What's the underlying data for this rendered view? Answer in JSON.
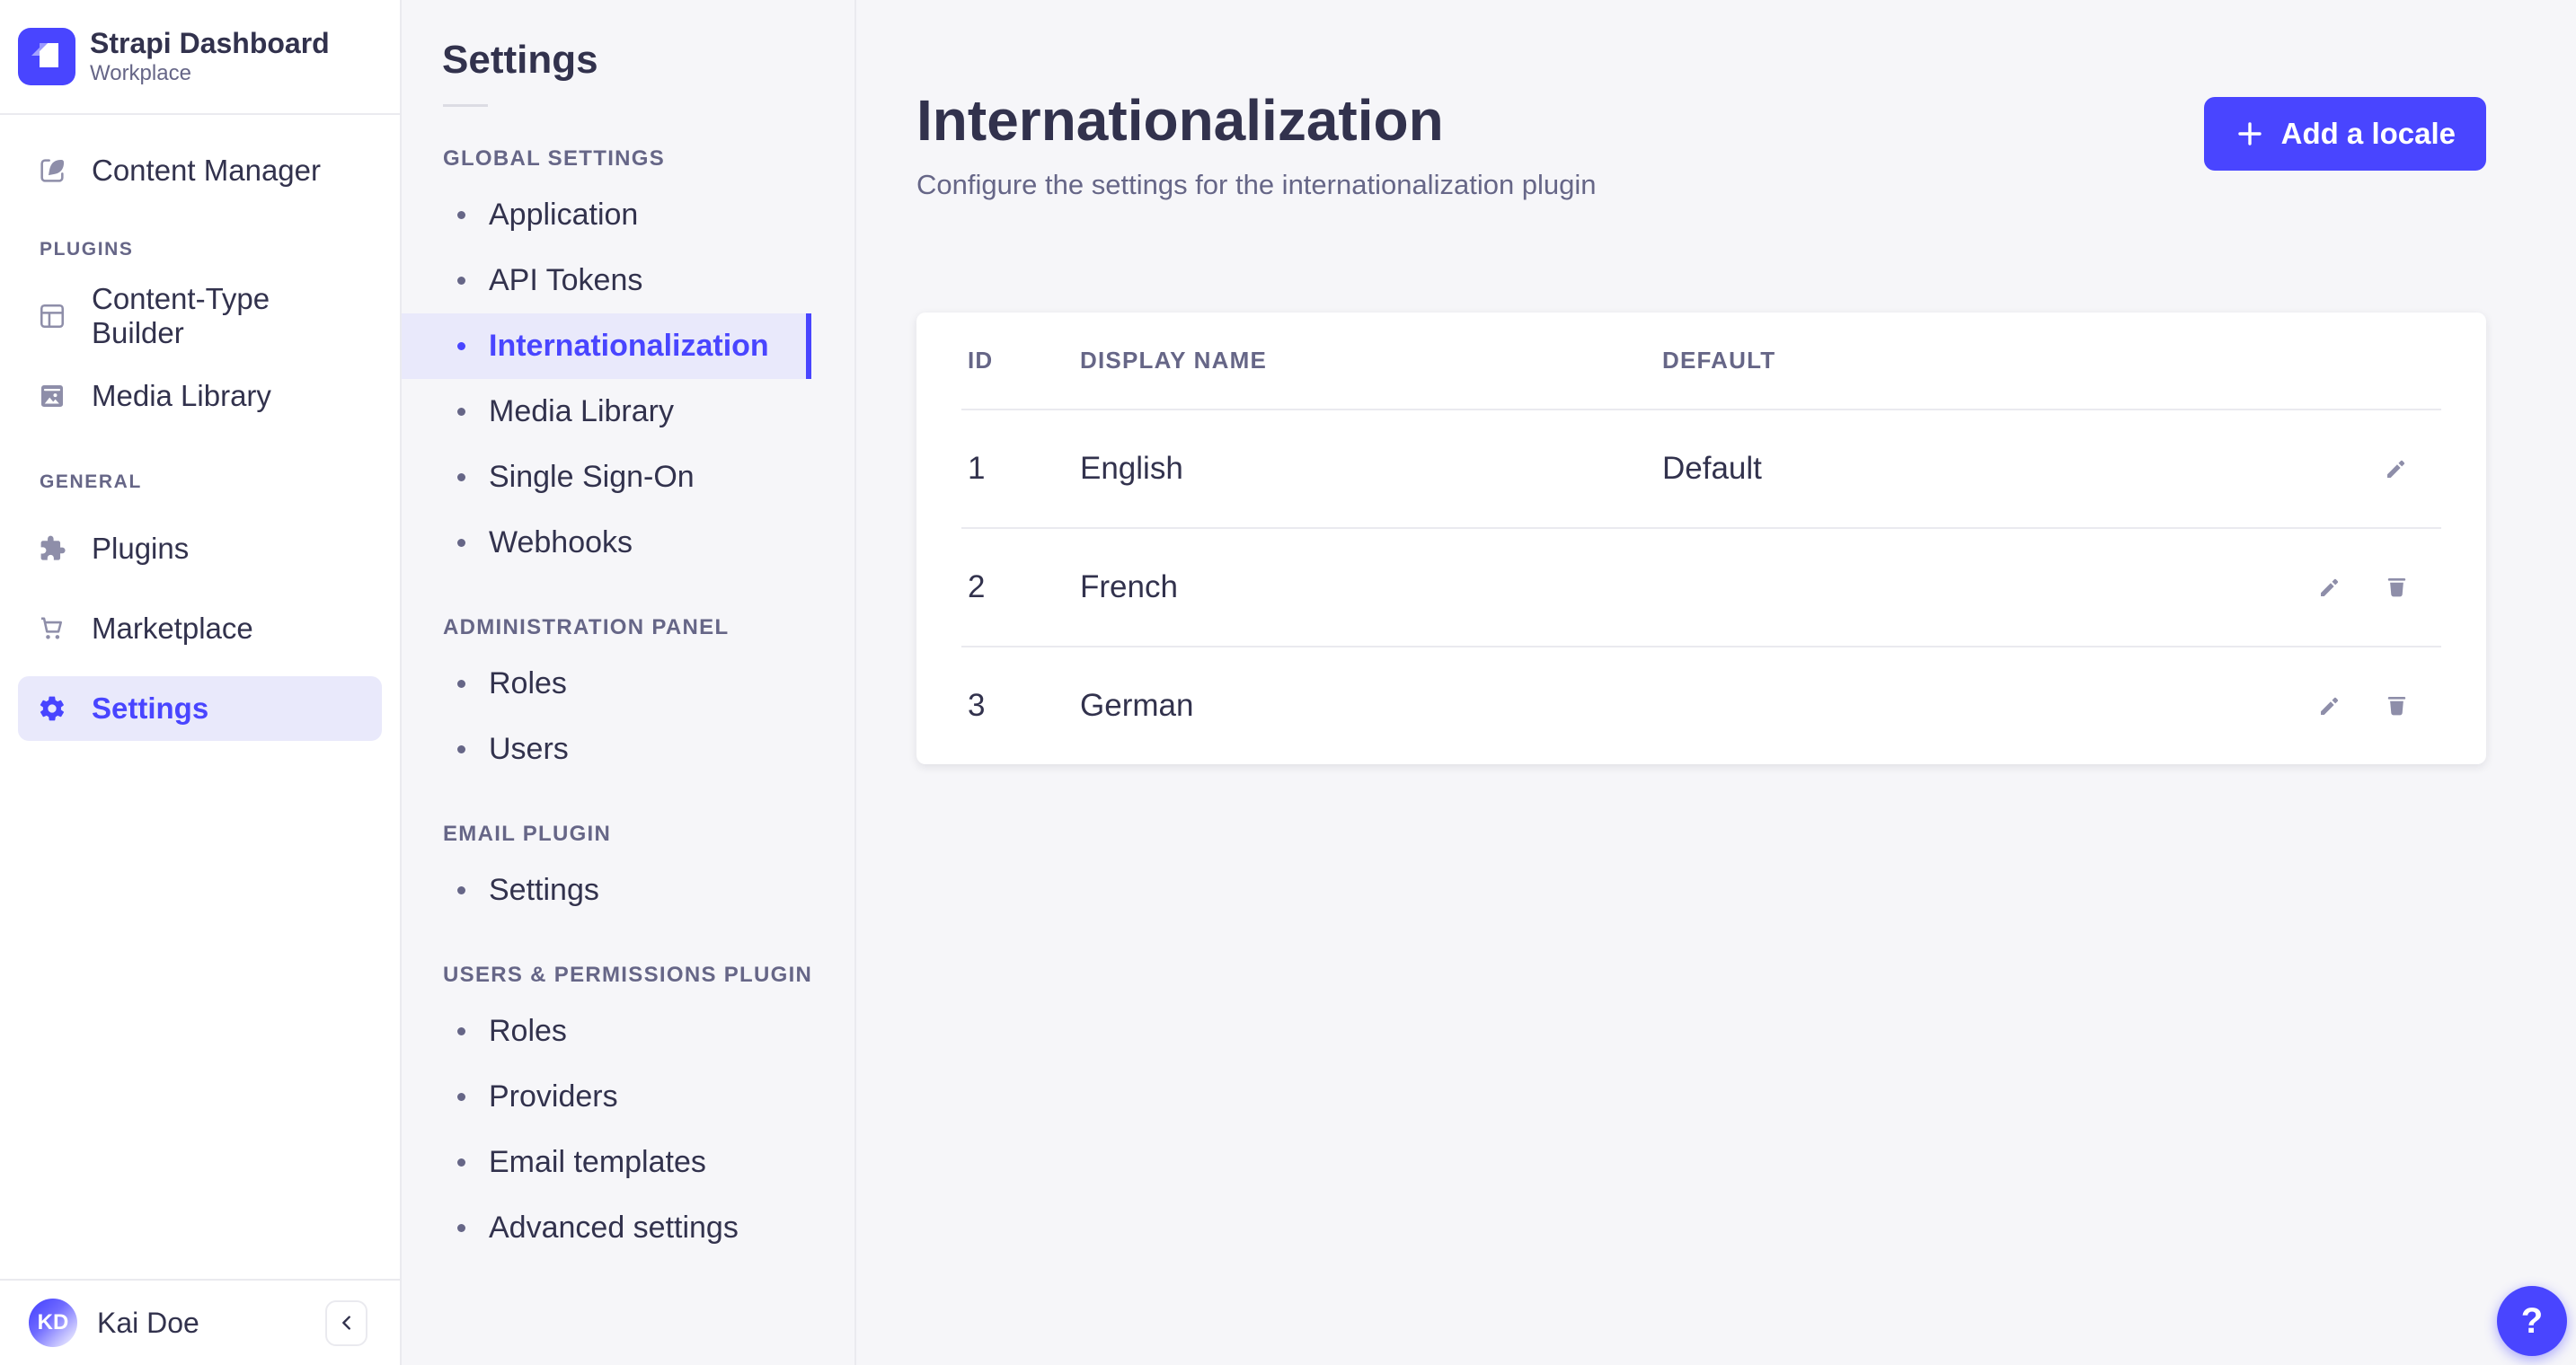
{
  "app": {
    "title": "Strapi Dashboard",
    "subtitle": "Workplace"
  },
  "colors": {
    "accent": "#4945ff",
    "accent_soft": "#e9e9fb",
    "text": "#32324d",
    "muted": "#666687",
    "icon_gray": "#8e8ea9",
    "border": "#eaeaef",
    "page_bg": "#f6f6f9",
    "card_bg": "#ffffff"
  },
  "sidebar": {
    "sections": [
      {
        "label": "",
        "items": [
          {
            "label": "Content Manager",
            "icon": "content-manager-icon"
          }
        ]
      },
      {
        "label": "PLUGINS",
        "items": [
          {
            "label": "Content-Type Builder",
            "icon": "content-type-builder-icon"
          },
          {
            "label": "Media Library",
            "icon": "media-library-icon"
          }
        ]
      },
      {
        "label": "GENERAL",
        "items": [
          {
            "label": "Plugins",
            "icon": "plugins-icon"
          },
          {
            "label": "Marketplace",
            "icon": "marketplace-icon"
          },
          {
            "label": "Settings",
            "icon": "settings-gear-icon",
            "active": true
          }
        ]
      }
    ],
    "user": {
      "initials": "KD",
      "name": "Kai Doe"
    }
  },
  "subnav": {
    "title": "Settings",
    "sections": [
      {
        "label": "GLOBAL SETTINGS",
        "items": [
          {
            "label": "Application"
          },
          {
            "label": "API Tokens"
          },
          {
            "label": "Internationalization",
            "active": true
          },
          {
            "label": "Media Library"
          },
          {
            "label": "Single Sign-On"
          },
          {
            "label": "Webhooks"
          }
        ]
      },
      {
        "label": "ADMINISTRATION PANEL",
        "items": [
          {
            "label": "Roles"
          },
          {
            "label": "Users"
          }
        ]
      },
      {
        "label": "EMAIL PLUGIN",
        "items": [
          {
            "label": "Settings"
          }
        ]
      },
      {
        "label": "USERS & PERMISSIONS PLUGIN",
        "items": [
          {
            "label": "Roles"
          },
          {
            "label": "Providers"
          },
          {
            "label": "Email templates"
          },
          {
            "label": "Advanced settings"
          }
        ]
      }
    ]
  },
  "main": {
    "title": "Internationalization",
    "subtitle": "Configure the settings for the internationalization plugin",
    "add_button": "Add a locale",
    "table": {
      "headers": {
        "id": "ID",
        "name": "DISPLAY NAME",
        "default": "DEFAULT"
      },
      "rows": [
        {
          "id": "1",
          "name": "English",
          "default": "Default"
        },
        {
          "id": "2",
          "name": "French",
          "default": ""
        },
        {
          "id": "3",
          "name": "German",
          "default": ""
        }
      ]
    }
  },
  "help": {
    "label": "?"
  }
}
